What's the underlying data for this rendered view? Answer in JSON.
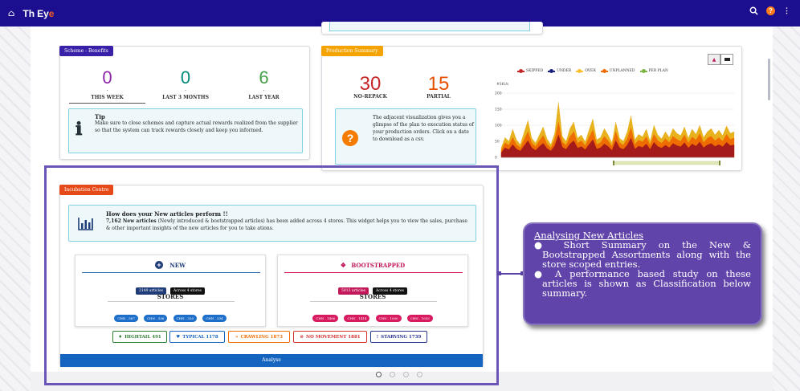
{
  "app": {
    "brand_prefix": "Th",
    "brand_mid": "Ey",
    "brand_accent": "e"
  },
  "scheme": {
    "tag": "Scheme - Benefits",
    "stats": [
      {
        "value": "0",
        "label": "THIS WEEK",
        "color": "#8e24aa"
      },
      {
        "value": "0",
        "label": "LAST 3 MONTHS",
        "color": "#00897b"
      },
      {
        "value": "6",
        "label": "LAST YEAR",
        "color": "#43a047"
      }
    ],
    "tip_title": "Tip",
    "tip_text": "Make sure to close schemes and capture actual rewards realized from the supplier so that the system can track rewards closely and keep you informed."
  },
  "production": {
    "tag": "Production Summary",
    "stats": [
      {
        "value": "30",
        "label": "NO-REPACK",
        "color": "#c62828"
      },
      {
        "value": "15",
        "label": "PARTIAL",
        "color": "#e65100"
      }
    ],
    "info_text": "The adjacent visualization gives you a glimpse of the plan to execution status of your production orders. Click on a date to download as a csv."
  },
  "chart_data": {
    "type": "area",
    "ylabel": "#SKUs",
    "yticks": [
      "200",
      "150",
      "100",
      "50",
      "0"
    ],
    "ylim": [
      0,
      200
    ],
    "legend": [
      "SKIPPED",
      "UNDER",
      "OVER",
      "UNPLANNED",
      "PER PLAN"
    ],
    "colors": {
      "SKIPPED": "#c62828",
      "UNDER": "#1a237e",
      "OVER": "#fbc02d",
      "UNPLANNED": "#ef6c00",
      "PER PLAN": "#7cb342"
    },
    "series": [
      {
        "name": "OVER",
        "color": "#e8b21f",
        "values": [
          30,
          62,
          50,
          88,
          55,
          40,
          78,
          115,
          60,
          45,
          70,
          95,
          58,
          40,
          75,
          172,
          65,
          50,
          90,
          110,
          60,
          70,
          48,
          85,
          120,
          55,
          62,
          90,
          70,
          45,
          110,
          60,
          50,
          80,
          130,
          55,
          72,
          64,
          88,
          50,
          100,
          70,
          58,
          80,
          62,
          90,
          75,
          68,
          95,
          60,
          88,
          72,
          100,
          62,
          80,
          90,
          70,
          85,
          68,
          98,
          75,
          80
        ]
      },
      {
        "name": "UNPLANNED",
        "color": "#ef6c00",
        "values": [
          22,
          45,
          38,
          62,
          40,
          30,
          55,
          80,
          45,
          34,
          52,
          68,
          42,
          30,
          55,
          110,
          48,
          38,
          65,
          80,
          44,
          52,
          36,
          62,
          85,
          40,
          46,
          65,
          52,
          34,
          80,
          45,
          38,
          58,
          92,
          40,
          54,
          48,
          64,
          38,
          72,
          52,
          44,
          58,
          46,
          66,
          56,
          50,
          70,
          44,
          64,
          54,
          74,
          46,
          60,
          66,
          52,
          62,
          50,
          72,
          56,
          60
        ]
      },
      {
        "name": "SKIPPED",
        "color": "#a31b1b",
        "values": [
          14,
          30,
          24,
          40,
          26,
          20,
          36,
          52,
          30,
          22,
          34,
          44,
          28,
          20,
          36,
          70,
          32,
          25,
          42,
          52,
          29,
          34,
          24,
          40,
          55,
          26,
          30,
          42,
          34,
          22,
          52,
          30,
          25,
          38,
          60,
          26,
          35,
          31,
          42,
          25,
          47,
          34,
          29,
          38,
          30,
          43,
          37,
          33,
          46,
          29,
          42,
          35,
          48,
          30,
          39,
          43,
          34,
          40,
          33,
          47,
          37,
          39
        ]
      }
    ]
  },
  "incubation": {
    "tag": "Incubation Centre",
    "title": "How does your New articles perform !!",
    "desc_bold": "7,162 New articles",
    "desc_rest": " (Newly introduced & bootstrapped articles) has been added across 4 stores. This widget helps you to view the sales, purchase & other important insights of the new articles for you to take ations.",
    "new": {
      "title": "NEW",
      "articles": "2149 articles",
      "across": "Across 4 stores",
      "stores_label": "STORES",
      "stores": [
        "CHN . 567",
        "CHN . 536",
        "CHN . 320",
        "CHN . 334"
      ]
    },
    "boot": {
      "title": "BOOTSTRAPPED",
      "articles": "5013 articles",
      "across": "Across 4 stores",
      "stores_label": "STORES",
      "stores": [
        "CHN . 1486",
        "CHN . 1414",
        "CHN . 1000",
        "CHN . 1053"
      ]
    },
    "classes": [
      {
        "label": "HIGHTAIL 491",
        "color": "#2e7d32"
      },
      {
        "label": "TYPICAL 1178",
        "color": "#1565c0"
      },
      {
        "label": "CRAWLING 1873",
        "color": "#ef6c00"
      },
      {
        "label": "NO MOVEMENT 1881",
        "color": "#d32f2f"
      },
      {
        "label": "STARVING 1739",
        "color": "#283593"
      }
    ],
    "analyse": "Analyse"
  },
  "tooltip": {
    "title": "Analysing New Articles",
    "bullets": [
      "Short Summary on the New & Bootstrapped Assortments along with the store scoped entries.",
      "A performance based study on these articles is shown as  Classification below summary."
    ]
  }
}
